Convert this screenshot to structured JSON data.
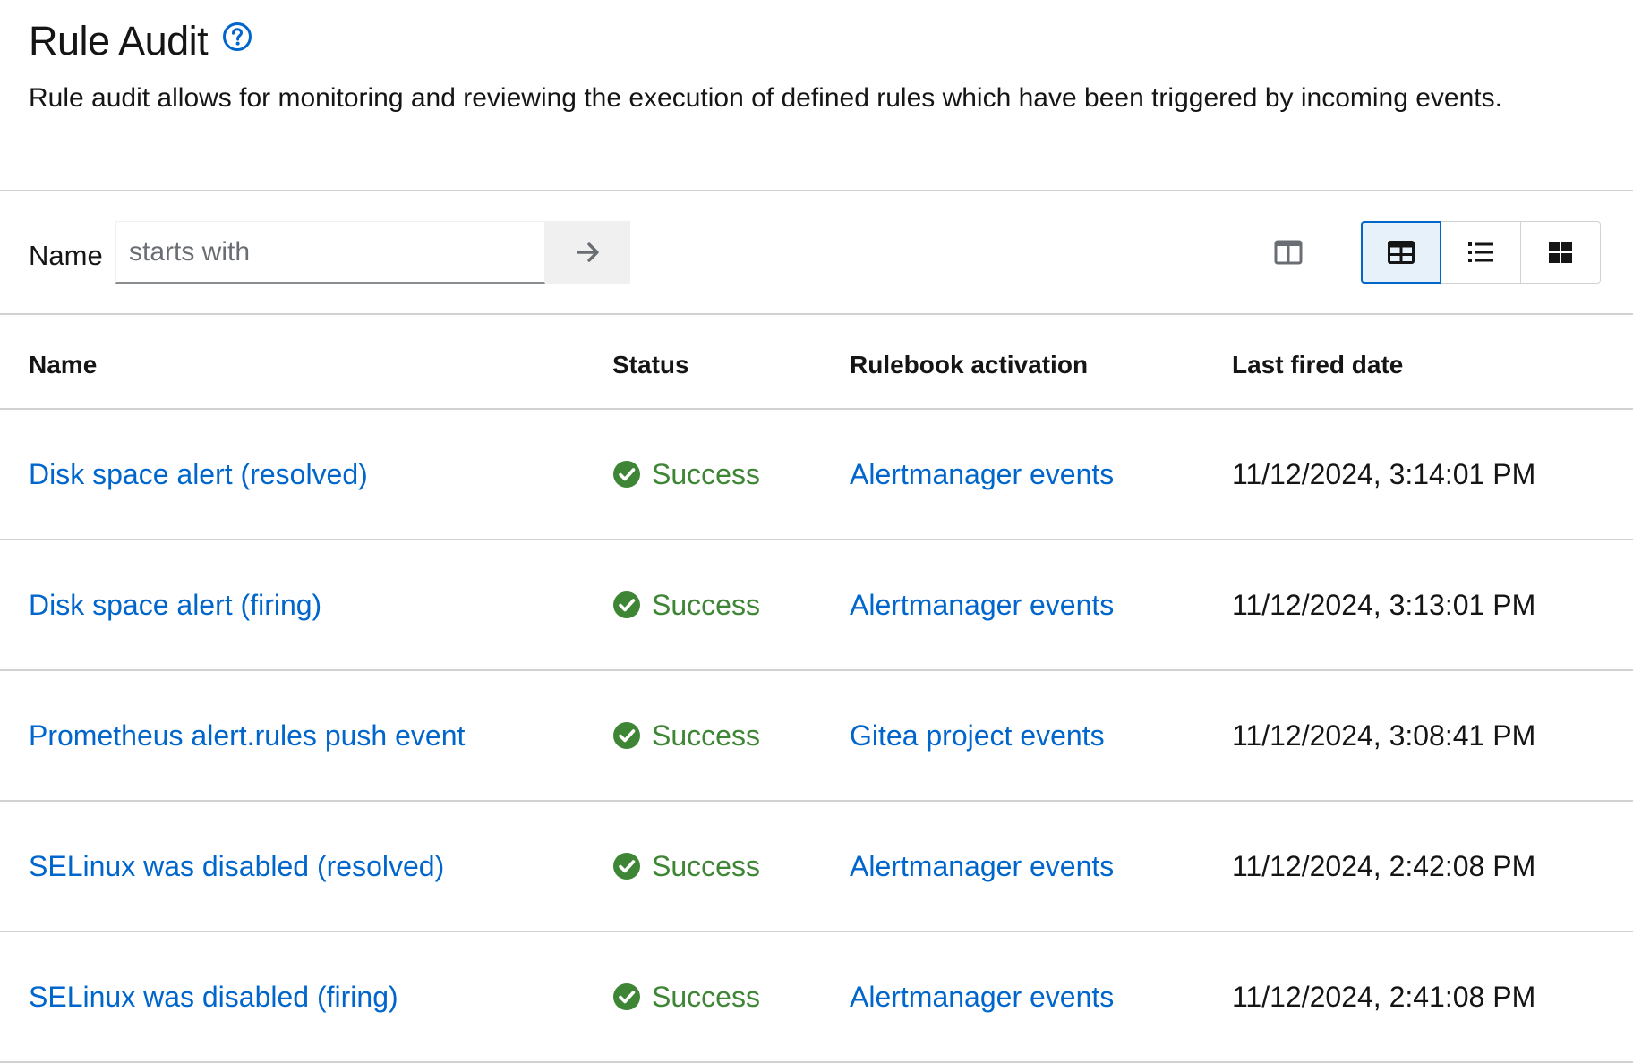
{
  "header": {
    "title": "Rule Audit",
    "description": "Rule audit allows for monitoring and reviewing the execution of defined rules which have been triggered by incoming events."
  },
  "toolbar": {
    "filter_label": "Name",
    "filter_placeholder": "starts with",
    "filter_value": ""
  },
  "table": {
    "columns": [
      "Name",
      "Status",
      "Rulebook activation",
      "Last fired date"
    ],
    "rows": [
      {
        "name": "Disk space alert (resolved)",
        "status": "Success",
        "activation": "Alertmanager events",
        "last_fired": "11/12/2024, 3:14:01 PM"
      },
      {
        "name": "Disk space alert (firing)",
        "status": "Success",
        "activation": "Alertmanager events",
        "last_fired": "11/12/2024, 3:13:01 PM"
      },
      {
        "name": "Prometheus alert.rules push event",
        "status": "Success",
        "activation": "Gitea project events",
        "last_fired": "11/12/2024, 3:08:41 PM"
      },
      {
        "name": "SELinux was disabled (resolved)",
        "status": "Success",
        "activation": "Alertmanager events",
        "last_fired": "11/12/2024, 2:42:08 PM"
      },
      {
        "name": "SELinux was disabled (firing)",
        "status": "Success",
        "activation": "Alertmanager events",
        "last_fired": "11/12/2024, 2:41:08 PM"
      }
    ]
  },
  "icons": {
    "help": "help-icon",
    "search_submit": "arrow-right-icon",
    "manage_columns": "columns-icon",
    "view_table": "table-icon",
    "view_list": "list-icon",
    "view_cards": "grid-icon",
    "status": "check-circle-icon"
  },
  "colors": {
    "link": "#0066cc",
    "success": "#3e8635",
    "active_view_bg": "#e7f1fa",
    "border": "#d2d2d2"
  },
  "active_view": "table"
}
